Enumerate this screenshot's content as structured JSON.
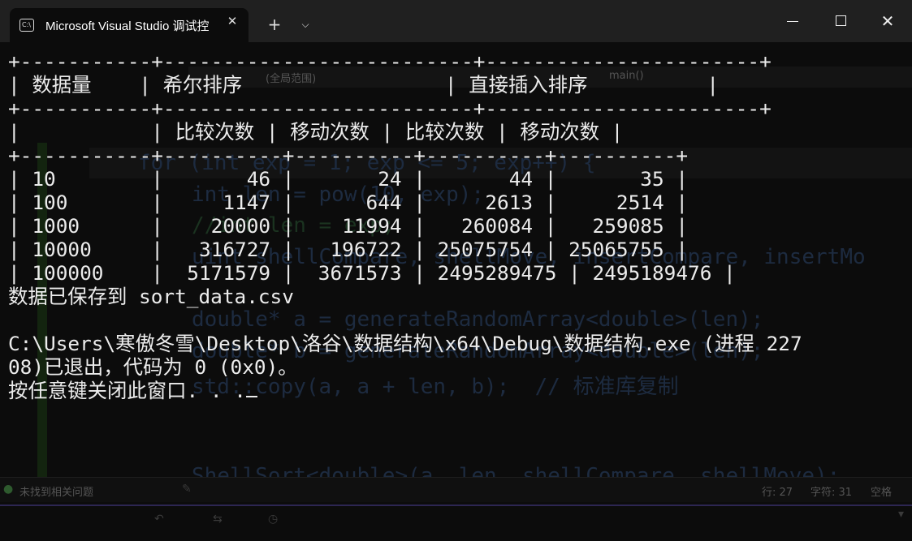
{
  "window": {
    "tab_title": "Microsoft Visual Studio 调试控",
    "tab_icon_text": "C:\\"
  },
  "console": {
    "lines": [
      "+-----------+--------------------------+-----------------------+",
      "| 数据量    | 希尔排序                 | 直接插入排序          |",
      "+-----------+--------------------------+-----------------------+",
      "|           | 比较次数 | 移动次数 | 比较次数 | 移动次数 |",
      "+-----------+----------+----------+----------+----------+",
      "| 10        |       46 |       24 |       44 |       35 |",
      "| 100       |     1147 |      644 |     2613 |     2514 |",
      "| 1000      |    20000 |    11994 |   260084 |   259085 |",
      "| 10000     |   316727 |   196722 | 25075754 | 25065755 |",
      "| 100000    |  5171579 |  3671573 | 2495289475 | 2495189476 |",
      "数据已保存到 sort_data.csv",
      "",
      "C:\\Users\\寒傲冬雪\\Desktop\\洛谷\\数据结构\\x64\\Debug\\数据结构.exe (进程 227",
      "08)已退出，代码为 0 (0x0)。",
      "按任意键关闭此窗口. . ."
    ]
  },
  "ide_background": {
    "code_lines": [
      "for (int exp = 1; exp <= 5; exp++) {",
      "int len = pow(10, exp);",
      "//int len = exp;",
      "uint shellCompare, shellMove, insertCompare, insertMo",
      "double* a = generateRandomArray<double>(len);",
      "double* b = generateRandomArray<double>(len);",
      "std::copy(a, a + len, b);  // 标准库复制",
      "ShellSort<double>(a, len, shellCompare, shellMove);"
    ],
    "scope_label": "(全局范围)",
    "function_label": "main()",
    "status_issues": "未找到相关问题",
    "status_line": "行: 27",
    "status_char": "字符: 31",
    "status_space": "空格"
  }
}
